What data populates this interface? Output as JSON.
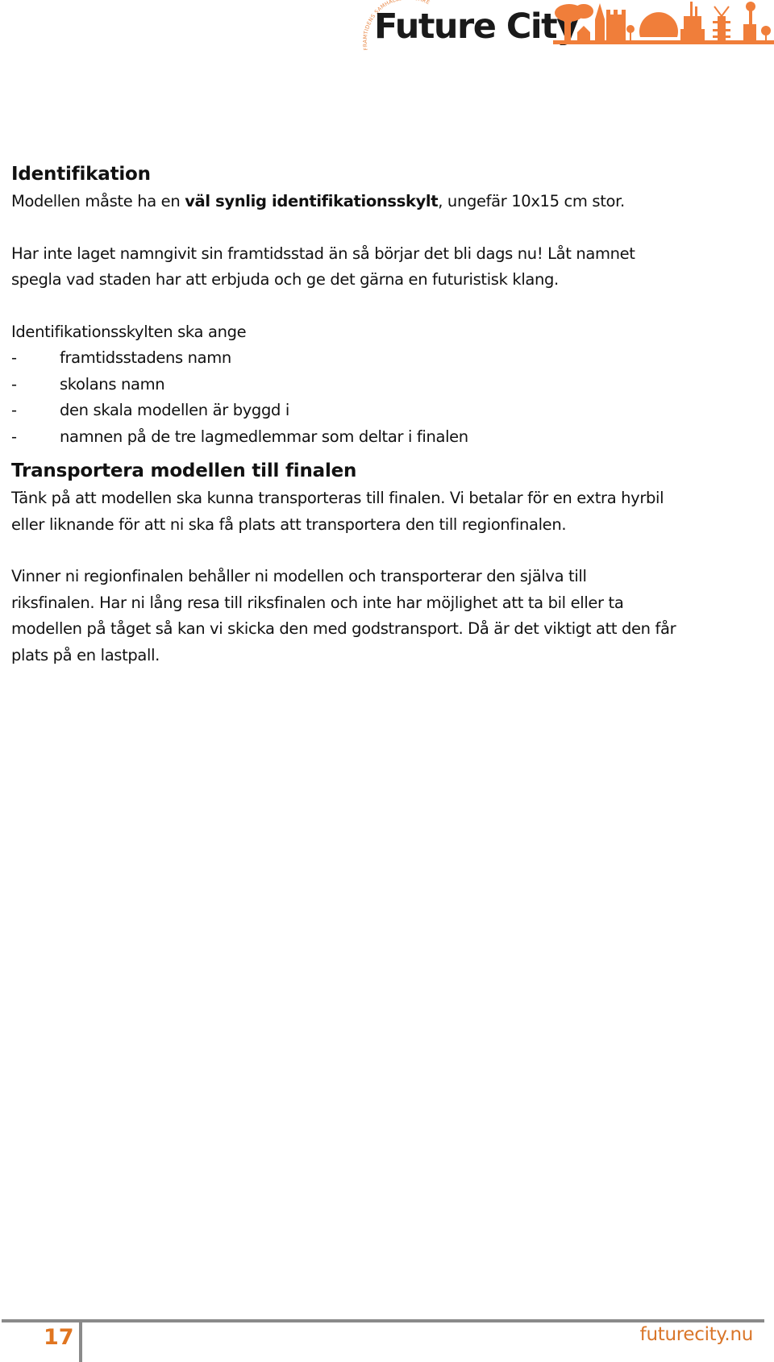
{
  "header": {
    "logo": {
      "wordmark": "Future City",
      "arc_text": "FRAMTIDENS SAMHÄLLSBYGGARE",
      "icon": "city-skyline-icon",
      "accent_color": "#f07e3a"
    }
  },
  "sections": [
    {
      "heading": "Identifikation",
      "paragraphs": [
        {
          "prefix": "Modellen måste ha en ",
          "bold": "väl synlig identifikationsskylt",
          "suffix": ", ungefär 10x15 cm stor."
        },
        {
          "lines": [
            "Har inte laget namngivit sin framtidsstad än så börjar det bli dags nu! Låt namnet",
            "spegla vad staden har att erbjuda och ge det gärna en futuristisk klang."
          ]
        },
        {
          "intro": "Identifikationsskylten ska ange",
          "list_marker": "-",
          "items": [
            "framtidsstadens namn",
            "skolans namn",
            "den skala modellen är byggd i",
            "namnen på de tre lagmedlemmar som deltar i finalen"
          ]
        }
      ]
    },
    {
      "heading": "Transportera modellen till finalen",
      "paragraphs": [
        {
          "lines": [
            "Tänk på att modellen ska kunna transporteras till finalen. Vi betalar för en extra hyrbil",
            "eller liknande för att ni ska få plats att transportera den till regionfinalen."
          ]
        },
        {
          "lines": [
            "Vinner ni regionfinalen behåller ni modellen och transporterar den själva till",
            "riksfinalen. Har ni lång resa till riksfinalen och inte har möjlighet att ta bil eller ta",
            "modellen på tåget så kan vi skicka den med godstransport. Då är det viktigt att den får",
            "plats på en lastpall."
          ]
        }
      ]
    }
  ],
  "footer": {
    "page_number": "17",
    "url": "futurecity.nu",
    "accent_color": "#e07520"
  }
}
